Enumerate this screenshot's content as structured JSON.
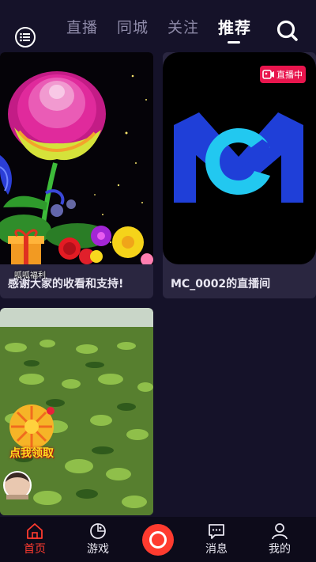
{
  "header": {
    "tabs": [
      {
        "label": "直播"
      },
      {
        "label": "同城"
      },
      {
        "label": "关注"
      },
      {
        "label": "推荐"
      }
    ],
    "active_tab": "推荐"
  },
  "feed": {
    "cards": [
      {
        "title": "感谢大家的收看和支持!",
        "overlay_label": "呱呱福利"
      },
      {
        "title": "MC_0002的直播间",
        "badge": "直播中"
      },
      {
        "overlay_label": "点我领取"
      }
    ]
  },
  "bottom_nav": {
    "items": [
      {
        "label": "首页"
      },
      {
        "label": "游戏"
      },
      {
        "label": "消息"
      },
      {
        "label": "我的"
      }
    ],
    "active_item": "首页"
  },
  "colors": {
    "accent": "#ff3b2f",
    "live_badge": "#e8154d",
    "background": "#151229",
    "mc_blue": "#1f3fd8",
    "mc_cyan": "#22c8f0"
  }
}
